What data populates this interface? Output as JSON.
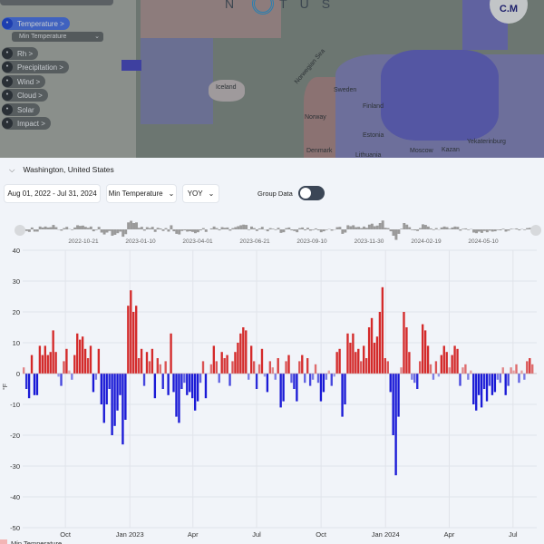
{
  "app": {
    "logo_text": "NOTUS",
    "user_initials": "C.M"
  },
  "map": {
    "layers": [
      {
        "label": "Temperature >",
        "icon": "thermometer-icon",
        "active": true
      },
      {
        "label": "Rh >",
        "icon": "humidity-icon"
      },
      {
        "label": "Precipitation >",
        "icon": "umbrella-icon"
      },
      {
        "label": "Wind >",
        "icon": "wind-icon"
      },
      {
        "label": "Cloud >",
        "icon": "cloud-icon"
      },
      {
        "label": "Solar",
        "icon": "sun-icon"
      },
      {
        "label": "Impact >",
        "icon": "impact-icon"
      }
    ],
    "sublayer": "Min Temperature",
    "place_labels": [
      "Iceland",
      "Norwegian Sea",
      "Sweden",
      "Finland",
      "Norway",
      "Estonia",
      "Denmark",
      "Lithuania",
      "Moscow",
      "Kazan",
      "Yekaterinburg"
    ]
  },
  "panel": {
    "location": "Washington, United States",
    "date_range": "Aug 01, 2022 - Jul 31, 2024",
    "variable": "Min Temperature",
    "mode": "YOY",
    "group_label": "Group Data",
    "group_on": false
  },
  "navigator": {
    "ticks": [
      "2022-10-21",
      "2023-01-10",
      "2023-04-01",
      "2023-06-21",
      "2023-09-10",
      "2023-11-30",
      "2024-02-19",
      "2024-05-10"
    ]
  },
  "colors": {
    "positive": "#d42a2a",
    "negative": "#1a1ad6",
    "accent": "#2a5bd7"
  },
  "chart_data": {
    "type": "bar",
    "x_start": "2022-08-01",
    "x_end": "2024-07-31",
    "ylabel": "°F",
    "ylim": [
      -50,
      40
    ],
    "yticks": [
      40,
      30,
      20,
      10,
      0,
      -10,
      -20,
      -30,
      -40,
      -50
    ],
    "xticks": [
      {
        "date": "2022-10-01",
        "label": "Oct"
      },
      {
        "date": "2023-01-01",
        "label": "Jan 2023"
      },
      {
        "date": "2023-04-01",
        "label": "Apr"
      },
      {
        "date": "2023-07-01",
        "label": "Jul"
      },
      {
        "date": "2023-10-01",
        "label": "Oct"
      },
      {
        "date": "2024-01-01",
        "label": "Jan 2024"
      },
      {
        "date": "2024-04-01",
        "label": "Apr"
      },
      {
        "date": "2024-07-01",
        "label": "Jul"
      }
    ],
    "grid": true,
    "legend": {
      "name": "Min Temperature",
      "placement": "bottom-left"
    },
    "values": [
      2,
      -5,
      -8,
      6,
      -7,
      -7,
      9,
      6,
      9,
      6,
      7,
      14,
      7,
      -1,
      -4,
      4,
      8,
      1,
      -2,
      6,
      13,
      11,
      12,
      8,
      5,
      9,
      -6,
      -2,
      8,
      -10,
      -16,
      -10,
      -5,
      -20,
      -17,
      -12,
      -7,
      -23,
      -15,
      22,
      27,
      20,
      22,
      5,
      8,
      -4,
      7,
      4,
      8,
      -8,
      5,
      3,
      -5,
      4,
      -7,
      13,
      -6,
      -14,
      -16,
      -5,
      -3,
      -7,
      -6,
      -8,
      -12,
      -9,
      -3,
      4,
      -8,
      0,
      3,
      9,
      4,
      -3,
      7,
      5,
      6,
      -4,
      4,
      7,
      10,
      13,
      15,
      14,
      -2,
      9,
      4,
      -5,
      3,
      8,
      -1,
      -6,
      4,
      2,
      -2,
      5,
      -11,
      -9,
      4,
      6,
      -3,
      -5,
      -9,
      4,
      6,
      -3,
      5,
      -4,
      -2,
      3,
      -3,
      -9,
      -6,
      -2,
      1,
      -4,
      -1,
      7,
      8,
      -14,
      -10,
      13,
      10,
      13,
      7,
      8,
      4,
      9,
      5,
      15,
      18,
      10,
      12,
      20,
      28,
      5,
      4,
      -6,
      -20,
      -33,
      -14,
      2,
      20,
      15,
      7,
      -2,
      -3,
      -5,
      4,
      16,
      14,
      9,
      3,
      -2,
      4,
      -1,
      6,
      9,
      7,
      2,
      6,
      9,
      8,
      -4,
      2,
      3,
      -2,
      1,
      -10,
      -12,
      -7,
      -11,
      -5,
      -9,
      -4,
      -7,
      -6,
      -2,
      -3,
      2,
      -7,
      -4,
      2,
      1,
      3,
      -3,
      1,
      -2,
      4,
      5,
      3
    ]
  }
}
